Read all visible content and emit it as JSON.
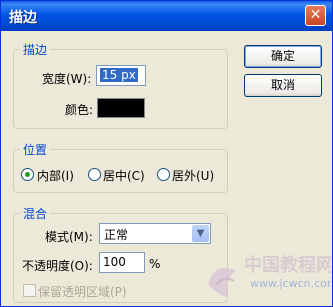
{
  "window": {
    "title": "描边",
    "close_glyph": "✕"
  },
  "stroke": {
    "legend": "描边",
    "width_label": "宽度(W):",
    "width_value": "15 px",
    "color_label": "颜色:",
    "color_value": "#000000"
  },
  "position": {
    "legend": "位置",
    "options": [
      "内部(I)",
      "居中(C)",
      "居外(U)"
    ],
    "selected": "内部(I)"
  },
  "blending": {
    "legend": "混合",
    "mode_label": "模式(M):",
    "mode_value": "正常",
    "opacity_label": "不透明度(O):",
    "opacity_value": "100",
    "opacity_unit": "%",
    "preserve_label": "保留透明区域(P)"
  },
  "buttons": {
    "ok": "确定",
    "cancel": "取消"
  },
  "watermark": {
    "text": "中国教程网",
    "url": "www.jcwcn.com"
  }
}
